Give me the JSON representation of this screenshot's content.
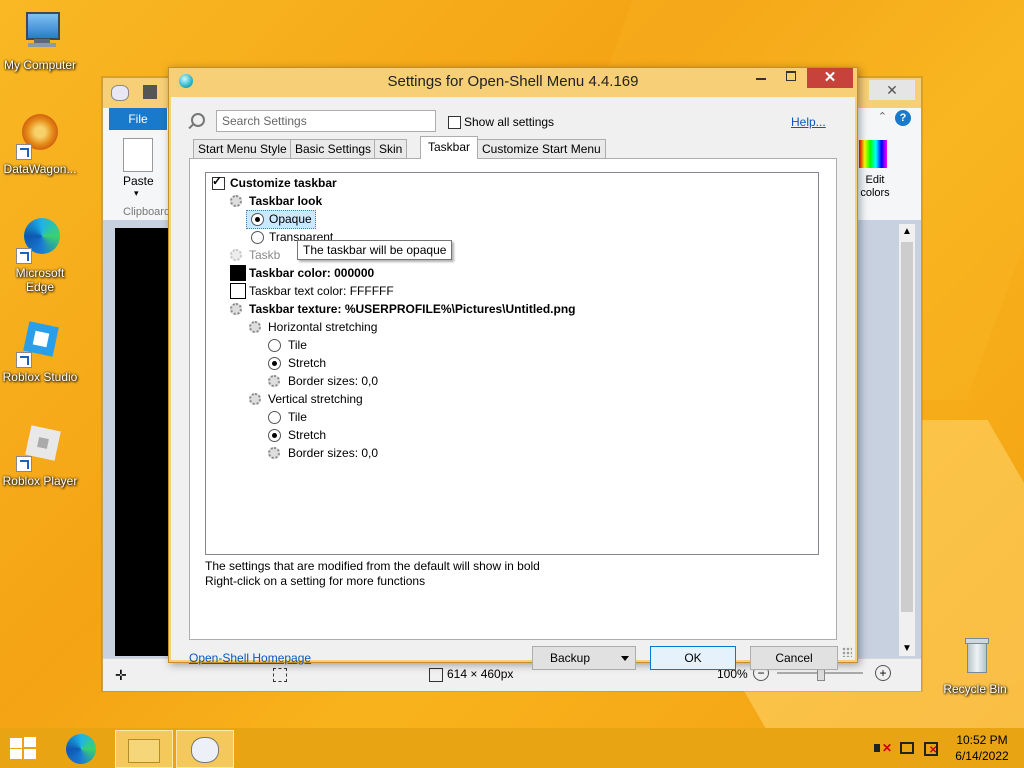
{
  "desktop": {
    "icons": [
      {
        "label": "My Computer"
      },
      {
        "label": "DataWagon..."
      },
      {
        "label": "Microsoft Edge"
      },
      {
        "label": "Roblox Studio"
      },
      {
        "label": "Roblox Player"
      },
      {
        "label": "Recycle Bin"
      }
    ]
  },
  "paint_window": {
    "file_tab": "File",
    "paste_label": "Paste",
    "clipboard_label": "Clipboard",
    "edit_colors_label": "Edit colors",
    "help_glyph": "?",
    "status": {
      "image_size": "614 × 460px",
      "zoom": "100%"
    }
  },
  "dialog": {
    "title": "Settings for Open-Shell Menu 4.4.169",
    "close_glyph": "✕",
    "search": {
      "placeholder": "Search Settings"
    },
    "show_all_label": "Show all settings",
    "help_link": "Help...",
    "tabs": [
      {
        "label": "Start Menu Style"
      },
      {
        "label": "Basic Settings"
      },
      {
        "label": "Skin"
      },
      {
        "label": "Taskbar"
      },
      {
        "label": "Customize Start Menu"
      }
    ],
    "active_tab": "Taskbar",
    "tree": {
      "customize_taskbar": "Customize taskbar",
      "taskbar_look": "Taskbar look",
      "opaque": "Opaque",
      "transparent": "Transparent",
      "taskbar_opacity_partial": "Taskb",
      "taskbar_color": "Taskbar color: 000000",
      "taskbar_text_color": "Taskbar text color: FFFFFF",
      "taskbar_texture": "Taskbar texture: %USERPROFILE%\\Pictures\\Untitled.png",
      "horizontal_stretching": "Horizontal stretching",
      "h_tile": "Tile",
      "h_stretch": "Stretch",
      "h_border": "Border sizes: 0,0",
      "vertical_stretching": "Vertical stretching",
      "v_tile": "Tile",
      "v_stretch": "Stretch",
      "v_border": "Border sizes: 0,0"
    },
    "tooltip": "The taskbar will be opaque",
    "info_line1": "The settings that are modified from the default will show in bold",
    "info_line2": "Right-click on a setting for more functions",
    "homepage_link": "Open-Shell Homepage",
    "buttons": {
      "backup": "Backup",
      "ok": "OK",
      "cancel": "Cancel"
    }
  },
  "taskbar": {
    "time": "10:52 PM",
    "date": "6/14/2022"
  },
  "colors": {
    "accent": "#f7cf76",
    "taskbar": "#e9a414",
    "link": "#0a56c2",
    "close_button": "#c7423a"
  }
}
